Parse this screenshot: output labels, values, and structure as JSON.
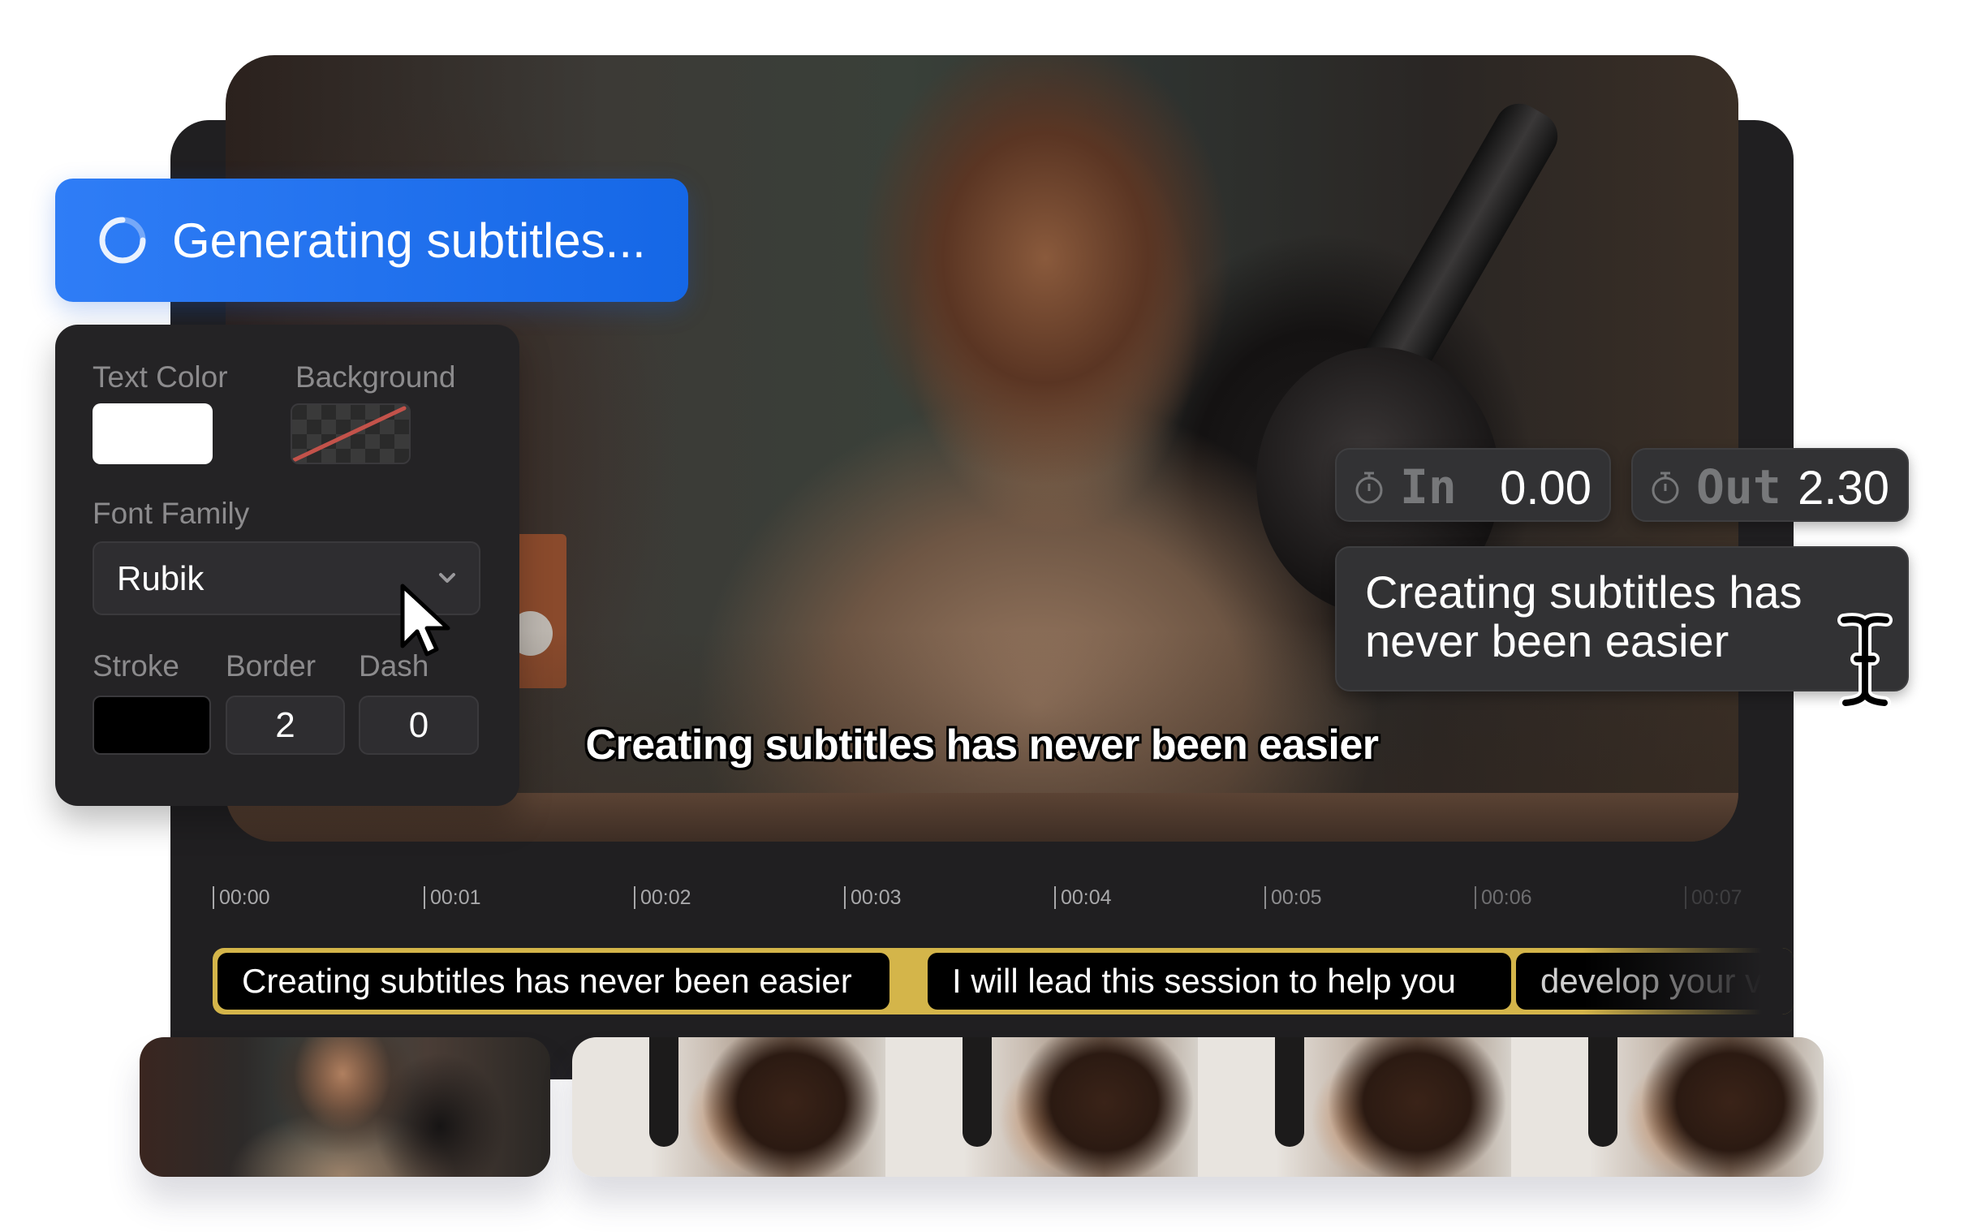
{
  "banner": {
    "text": "Generating subtitles...",
    "icon": "loading-spinner-icon",
    "color": "#1f6fee"
  },
  "style_panel": {
    "text_color": {
      "label": "Text Color",
      "value": "#ffffff"
    },
    "background": {
      "label": "Background",
      "value": "transparent"
    },
    "font_family": {
      "label": "Font Family",
      "value": "Rubik"
    },
    "stroke": {
      "label": "Stroke",
      "value": "#000000"
    },
    "border": {
      "label": "Border",
      "value": "2"
    },
    "dash": {
      "label": "Dash",
      "value": "0"
    }
  },
  "video": {
    "burned_subtitle": "Creating subtitles has never been easier"
  },
  "timing": {
    "in": {
      "label": "In",
      "value": "0.00",
      "icon": "stopwatch-icon"
    },
    "out": {
      "label": "Out",
      "value": "2.30",
      "icon": "stopwatch-icon"
    }
  },
  "subtitle_editor": {
    "text": "Creating subtitles has never been easier"
  },
  "timeline": {
    "ticks": [
      "00:00",
      "00:01",
      "00:02",
      "00:03",
      "00:04",
      "00:05",
      "00:06",
      "00:07"
    ],
    "clips": [
      {
        "text": "Creating subtitles has never been easier",
        "selected": true
      },
      {
        "text": "I will lead this session to help you",
        "selected": false
      },
      {
        "text": "develop your vlo",
        "selected": false
      }
    ],
    "accent_color": "#d4b54a"
  },
  "thumbnails": {
    "count": 5
  }
}
